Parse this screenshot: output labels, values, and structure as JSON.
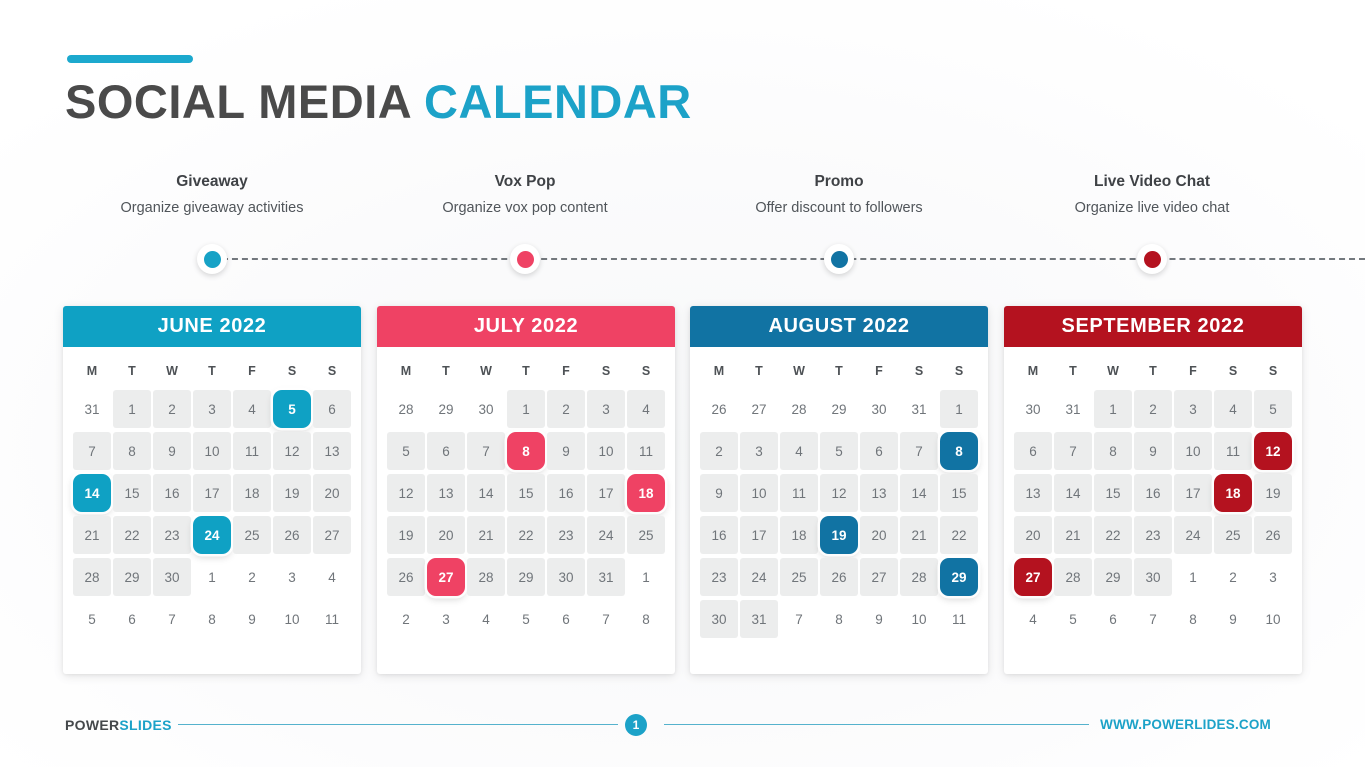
{
  "title": {
    "text_primary": "SOCIAL MEDIA ",
    "text_accent": "CALENDAR",
    "accent_color": "#1CA2C8"
  },
  "timeline": {
    "items": [
      {
        "title": "Giveaway",
        "subtitle": "Organize giveaway activities",
        "dot_color": "#17A2C6"
      },
      {
        "title": "Vox Pop",
        "subtitle": "Organize vox pop content",
        "dot_color": "#EF4264"
      },
      {
        "title": "Promo",
        "subtitle": "Offer discount to followers",
        "dot_color": "#1173A3"
      },
      {
        "title": "Live Video Chat",
        "subtitle": "Organize live video chat",
        "dot_color": "#B4121F"
      }
    ]
  },
  "weekdays": [
    "M",
    "T",
    "W",
    "T",
    "F",
    "S",
    "S"
  ],
  "calendars": [
    {
      "name": "JUNE 2022",
      "color": "#0FA1C4",
      "weeks": [
        [
          {
            "d": "31",
            "s": "out"
          },
          {
            "d": "1",
            "s": "in"
          },
          {
            "d": "2",
            "s": "in"
          },
          {
            "d": "3",
            "s": "in"
          },
          {
            "d": "4",
            "s": "in"
          },
          {
            "d": "5",
            "s": "hl"
          },
          {
            "d": "6",
            "s": "in"
          }
        ],
        [
          {
            "d": "7",
            "s": "in"
          },
          {
            "d": "8",
            "s": "in"
          },
          {
            "d": "9",
            "s": "in"
          },
          {
            "d": "10",
            "s": "in"
          },
          {
            "d": "11",
            "s": "in"
          },
          {
            "d": "12",
            "s": "in"
          },
          {
            "d": "13",
            "s": "in"
          }
        ],
        [
          {
            "d": "14",
            "s": "hl"
          },
          {
            "d": "15",
            "s": "in"
          },
          {
            "d": "16",
            "s": "in"
          },
          {
            "d": "17",
            "s": "in"
          },
          {
            "d": "18",
            "s": "in"
          },
          {
            "d": "19",
            "s": "in"
          },
          {
            "d": "20",
            "s": "in"
          }
        ],
        [
          {
            "d": "21",
            "s": "in"
          },
          {
            "d": "22",
            "s": "in"
          },
          {
            "d": "23",
            "s": "in"
          },
          {
            "d": "24",
            "s": "hl"
          },
          {
            "d": "25",
            "s": "in"
          },
          {
            "d": "26",
            "s": "in"
          },
          {
            "d": "27",
            "s": "in"
          }
        ],
        [
          {
            "d": "28",
            "s": "in"
          },
          {
            "d": "29",
            "s": "in"
          },
          {
            "d": "30",
            "s": "in"
          },
          {
            "d": "1",
            "s": "out"
          },
          {
            "d": "2",
            "s": "out"
          },
          {
            "d": "3",
            "s": "out"
          },
          {
            "d": "4",
            "s": "out"
          }
        ],
        [
          {
            "d": "5",
            "s": "out"
          },
          {
            "d": "6",
            "s": "out"
          },
          {
            "d": "7",
            "s": "out"
          },
          {
            "d": "8",
            "s": "out"
          },
          {
            "d": "9",
            "s": "out"
          },
          {
            "d": "10",
            "s": "out"
          },
          {
            "d": "11",
            "s": "out"
          }
        ]
      ]
    },
    {
      "name": "JULY 2022",
      "color": "#EF4264",
      "weeks": [
        [
          {
            "d": "28",
            "s": "out"
          },
          {
            "d": "29",
            "s": "out"
          },
          {
            "d": "30",
            "s": "out"
          },
          {
            "d": "1",
            "s": "in"
          },
          {
            "d": "2",
            "s": "in"
          },
          {
            "d": "3",
            "s": "in"
          },
          {
            "d": "4",
            "s": "in"
          }
        ],
        [
          {
            "d": "5",
            "s": "in"
          },
          {
            "d": "6",
            "s": "in"
          },
          {
            "d": "7",
            "s": "in"
          },
          {
            "d": "8",
            "s": "hl"
          },
          {
            "d": "9",
            "s": "in"
          },
          {
            "d": "10",
            "s": "in"
          },
          {
            "d": "11",
            "s": "in"
          }
        ],
        [
          {
            "d": "12",
            "s": "in"
          },
          {
            "d": "13",
            "s": "in"
          },
          {
            "d": "14",
            "s": "in"
          },
          {
            "d": "15",
            "s": "in"
          },
          {
            "d": "16",
            "s": "in"
          },
          {
            "d": "17",
            "s": "in"
          },
          {
            "d": "18",
            "s": "hl"
          }
        ],
        [
          {
            "d": "19",
            "s": "in"
          },
          {
            "d": "20",
            "s": "in"
          },
          {
            "d": "21",
            "s": "in"
          },
          {
            "d": "22",
            "s": "in"
          },
          {
            "d": "23",
            "s": "in"
          },
          {
            "d": "24",
            "s": "in"
          },
          {
            "d": "25",
            "s": "in"
          }
        ],
        [
          {
            "d": "26",
            "s": "in"
          },
          {
            "d": "27",
            "s": "hl"
          },
          {
            "d": "28",
            "s": "in"
          },
          {
            "d": "29",
            "s": "in"
          },
          {
            "d": "30",
            "s": "in"
          },
          {
            "d": "31",
            "s": "in"
          },
          {
            "d": "1",
            "s": "out"
          }
        ],
        [
          {
            "d": "2",
            "s": "out"
          },
          {
            "d": "3",
            "s": "out"
          },
          {
            "d": "4",
            "s": "out"
          },
          {
            "d": "5",
            "s": "out"
          },
          {
            "d": "6",
            "s": "out"
          },
          {
            "d": "7",
            "s": "out"
          },
          {
            "d": "8",
            "s": "out"
          }
        ]
      ]
    },
    {
      "name": "AUGUST 2022",
      "color": "#1173A3",
      "weeks": [
        [
          {
            "d": "26",
            "s": "out"
          },
          {
            "d": "27",
            "s": "out"
          },
          {
            "d": "28",
            "s": "out"
          },
          {
            "d": "29",
            "s": "out"
          },
          {
            "d": "30",
            "s": "out"
          },
          {
            "d": "31",
            "s": "out"
          },
          {
            "d": "1",
            "s": "in"
          }
        ],
        [
          {
            "d": "2",
            "s": "in"
          },
          {
            "d": "3",
            "s": "in"
          },
          {
            "d": "4",
            "s": "in"
          },
          {
            "d": "5",
            "s": "in"
          },
          {
            "d": "6",
            "s": "in"
          },
          {
            "d": "7",
            "s": "in"
          },
          {
            "d": "8",
            "s": "hl"
          }
        ],
        [
          {
            "d": "9",
            "s": "in"
          },
          {
            "d": "10",
            "s": "in"
          },
          {
            "d": "11",
            "s": "in"
          },
          {
            "d": "12",
            "s": "in"
          },
          {
            "d": "13",
            "s": "in"
          },
          {
            "d": "14",
            "s": "in"
          },
          {
            "d": "15",
            "s": "in"
          }
        ],
        [
          {
            "d": "16",
            "s": "in"
          },
          {
            "d": "17",
            "s": "in"
          },
          {
            "d": "18",
            "s": "in"
          },
          {
            "d": "19",
            "s": "hl"
          },
          {
            "d": "20",
            "s": "in"
          },
          {
            "d": "21",
            "s": "in"
          },
          {
            "d": "22",
            "s": "in"
          }
        ],
        [
          {
            "d": "23",
            "s": "in"
          },
          {
            "d": "24",
            "s": "in"
          },
          {
            "d": "25",
            "s": "in"
          },
          {
            "d": "26",
            "s": "in"
          },
          {
            "d": "27",
            "s": "in"
          },
          {
            "d": "28",
            "s": "in"
          },
          {
            "d": "29",
            "s": "hl"
          }
        ],
        [
          {
            "d": "30",
            "s": "in"
          },
          {
            "d": "31",
            "s": "in"
          },
          {
            "d": "7",
            "s": "out"
          },
          {
            "d": "8",
            "s": "out"
          },
          {
            "d": "9",
            "s": "out"
          },
          {
            "d": "10",
            "s": "out"
          },
          {
            "d": "11",
            "s": "out"
          }
        ]
      ]
    },
    {
      "name": "SEPTEMBER 2022",
      "color": "#B4121F",
      "weeks": [
        [
          {
            "d": "30",
            "s": "out"
          },
          {
            "d": "31",
            "s": "out"
          },
          {
            "d": "1",
            "s": "in"
          },
          {
            "d": "2",
            "s": "in"
          },
          {
            "d": "3",
            "s": "in"
          },
          {
            "d": "4",
            "s": "in"
          },
          {
            "d": "5",
            "s": "in"
          }
        ],
        [
          {
            "d": "6",
            "s": "in"
          },
          {
            "d": "7",
            "s": "in"
          },
          {
            "d": "8",
            "s": "in"
          },
          {
            "d": "9",
            "s": "in"
          },
          {
            "d": "10",
            "s": "in"
          },
          {
            "d": "11",
            "s": "in"
          },
          {
            "d": "12",
            "s": "hl"
          }
        ],
        [
          {
            "d": "13",
            "s": "in"
          },
          {
            "d": "14",
            "s": "in"
          },
          {
            "d": "15",
            "s": "in"
          },
          {
            "d": "16",
            "s": "in"
          },
          {
            "d": "17",
            "s": "in"
          },
          {
            "d": "18",
            "s": "hl"
          },
          {
            "d": "19",
            "s": "in"
          }
        ],
        [
          {
            "d": "20",
            "s": "in"
          },
          {
            "d": "21",
            "s": "in"
          },
          {
            "d": "22",
            "s": "in"
          },
          {
            "d": "23",
            "s": "in"
          },
          {
            "d": "24",
            "s": "in"
          },
          {
            "d": "25",
            "s": "in"
          },
          {
            "d": "26",
            "s": "in"
          }
        ],
        [
          {
            "d": "27",
            "s": "hl"
          },
          {
            "d": "28",
            "s": "in"
          },
          {
            "d": "29",
            "s": "in"
          },
          {
            "d": "30",
            "s": "in"
          },
          {
            "d": "1",
            "s": "out"
          },
          {
            "d": "2",
            "s": "out"
          },
          {
            "d": "3",
            "s": "out"
          }
        ],
        [
          {
            "d": "4",
            "s": "out"
          },
          {
            "d": "5",
            "s": "out"
          },
          {
            "d": "6",
            "s": "out"
          },
          {
            "d": "7",
            "s": "out"
          },
          {
            "d": "8",
            "s": "out"
          },
          {
            "d": "9",
            "s": "out"
          },
          {
            "d": "10",
            "s": "out"
          }
        ]
      ]
    }
  ],
  "footer": {
    "brand_dark": "POWER",
    "brand_light": "SLIDES",
    "page_number": "1",
    "url": "WWW.POWERLIDES.COM",
    "accent_color": "#1CA2C8"
  }
}
